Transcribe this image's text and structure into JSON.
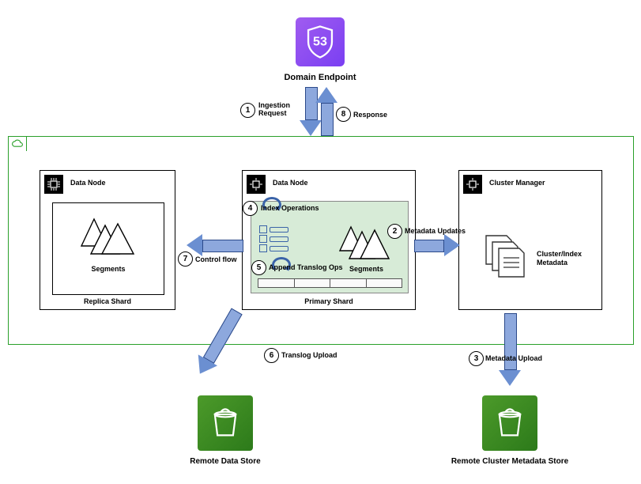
{
  "top": {
    "title": "Domain Endpoint",
    "route53": "53"
  },
  "steps": {
    "s1": {
      "n": "1",
      "label": "Ingestion\nRequest"
    },
    "s2": {
      "n": "2",
      "label": "Metadata Updates"
    },
    "s3": {
      "n": "3",
      "label": "Metadata Upload"
    },
    "s4": {
      "n": "4",
      "label": "Index Operations"
    },
    "s5": {
      "n": "5",
      "label": "Append Translog Ops"
    },
    "s6": {
      "n": "6",
      "label": "Translog Upload"
    },
    "s7": {
      "n": "7",
      "label": "Control flow"
    },
    "s8": {
      "n": "8",
      "label": "Response"
    }
  },
  "nodes": {
    "replica": {
      "title": "Data Node",
      "shard": "Replica Shard",
      "segments": "Segments"
    },
    "primary": {
      "title": "Data Node",
      "shard": "Primary Shard",
      "segments": "Segments"
    },
    "manager": {
      "title": "Cluster Manager",
      "meta": "Cluster/Index\nMetadata"
    }
  },
  "buckets": {
    "data": "Remote Data Store",
    "meta": "Remote Cluster Metadata Store"
  }
}
